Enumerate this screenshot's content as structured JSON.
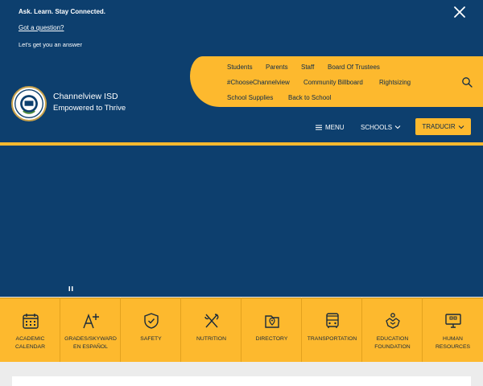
{
  "alert": {
    "title": "Ask. Learn. Stay Connected. ",
    "link": "Got a question?",
    "subtitle": "Let's get you an answer"
  },
  "site": {
    "name": "Channelview ISD",
    "tagline": "Empowered to Thrive"
  },
  "top_links": [
    {
      "label": "Students"
    },
    {
      "label": "Parents"
    },
    {
      "label": "Staff"
    },
    {
      "label": "Board Of Trustees"
    },
    {
      "label": "#ChooseChannelview"
    },
    {
      "label": "Community Billboard"
    },
    {
      "label": "Rightsizing"
    },
    {
      "label": "School Supplies"
    },
    {
      "label": "Back to School"
    }
  ],
  "nav": {
    "menu": "MENU",
    "schools": "SCHOOLS",
    "translate": "TRADUCIR"
  },
  "quick_links": [
    {
      "l1": "ACADEMIC",
      "l2": "CALENDAR",
      "icon": "calendar-icon"
    },
    {
      "l1": "GRADES/SKYWARD",
      "l2": "EN ESPAÑOL",
      "icon": "grade-aplus-icon"
    },
    {
      "l1": "SAFETY",
      "l2": "",
      "icon": "shield-check-icon"
    },
    {
      "l1": "NUTRITION",
      "l2": "",
      "icon": "utensils-icon"
    },
    {
      "l1": "DIRECTORY",
      "l2": "",
      "icon": "map-pin-folder-icon"
    },
    {
      "l1": "TRANSPORTATION",
      "l2": "",
      "icon": "bus-icon"
    },
    {
      "l1": "EDUCATION",
      "l2": "FOUNDATION",
      "icon": "handshake-icon"
    },
    {
      "l1": "HUMAN",
      "l2": "RESOURCES",
      "icon": "monitor-icon"
    }
  ],
  "colors": {
    "navy": "#0d3f6e",
    "gold": "#fdb92e"
  }
}
